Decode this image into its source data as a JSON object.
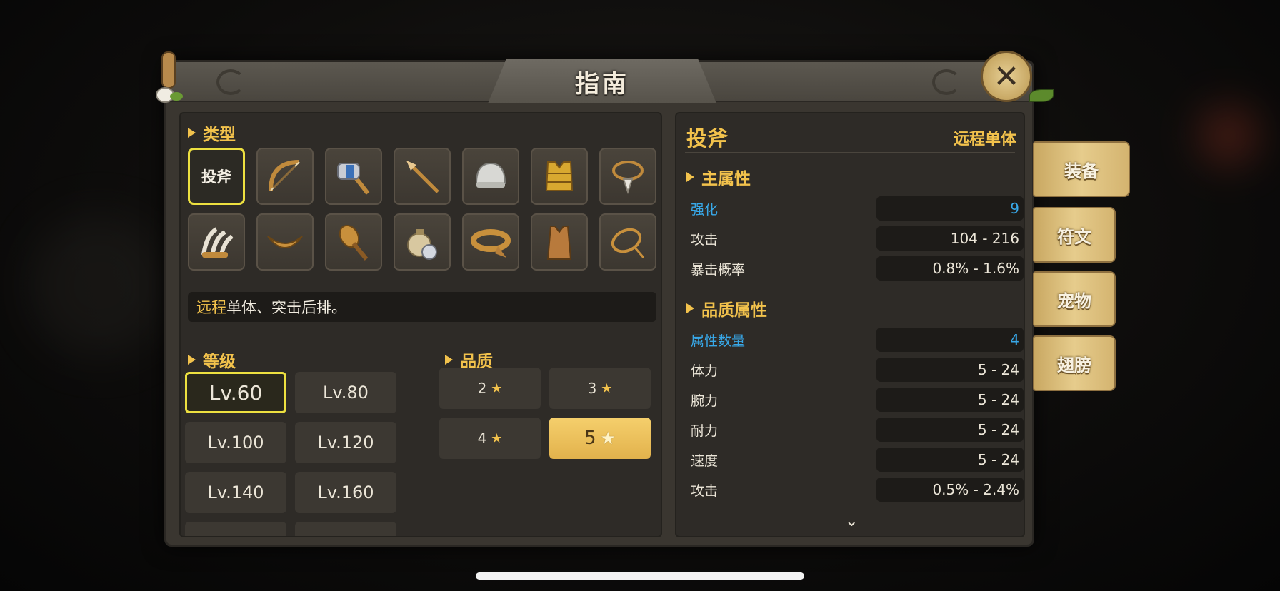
{
  "window": {
    "title": "指南"
  },
  "type_section": {
    "label": "类型",
    "selected_label": "投斧",
    "icons": [
      "bow-icon",
      "stone-hammer-icon",
      "spear-icon",
      "helmet-icon",
      "chest-armor-icon",
      "necklace-icon",
      "claw-icon",
      "boomerang-icon",
      "club-icon",
      "pouch-icon",
      "belt-icon",
      "tunic-icon",
      "rope-icon"
    ]
  },
  "description": {
    "highlight": "远程",
    "rest": "单体、突击后排。"
  },
  "level_section": {
    "label": "等级",
    "items": [
      "Lv.60",
      "Lv.80",
      "Lv.100",
      "Lv.120",
      "Lv.140",
      "Lv.160"
    ],
    "selected": "Lv.60"
  },
  "quality_section": {
    "label": "品质",
    "items": [
      "2",
      "3",
      "4",
      "5"
    ],
    "selected": "5"
  },
  "detail": {
    "name": "投斧",
    "subtype": "远程单体",
    "main_attr_label": "主属性",
    "main_attrs": [
      {
        "name": "强化",
        "value": "9",
        "highlight": true
      },
      {
        "name": "攻击",
        "value": "104 - 216",
        "highlight": false
      },
      {
        "name": "暴击概率",
        "value": "0.8% - 1.6%",
        "highlight": false
      }
    ],
    "quality_attr_label": "品质属性",
    "quality_attrs": [
      {
        "name": "属性数量",
        "value": "4",
        "highlight": true
      },
      {
        "name": "体力",
        "value": "5 - 24",
        "highlight": false
      },
      {
        "name": "腕力",
        "value": "5 - 24",
        "highlight": false
      },
      {
        "name": "耐力",
        "value": "5 - 24",
        "highlight": false
      },
      {
        "name": "速度",
        "value": "5 - 24",
        "highlight": false
      },
      {
        "name": "攻击",
        "value": "0.5% - 2.4%",
        "highlight": false
      }
    ],
    "scroll_glyph": "⌄"
  },
  "side_tabs": [
    "装备",
    "符文",
    "宠物",
    "翅膀"
  ],
  "close_glyph": "✕",
  "colors": {
    "accent_gold": "#f2c24c",
    "highlight_blue": "#38a8e8",
    "select_yellow": "#ede040"
  }
}
